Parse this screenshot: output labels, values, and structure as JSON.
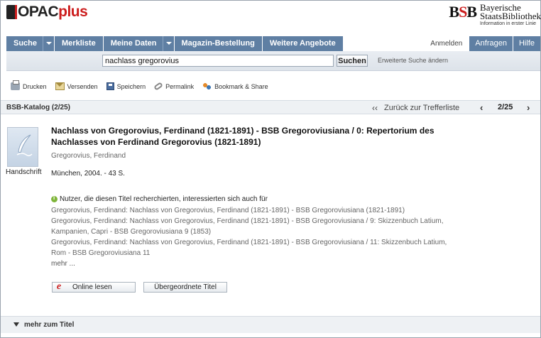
{
  "header": {
    "logo_opac": "OPAC",
    "logo_plus": "plus",
    "bsb_mark_b1": "B",
    "bsb_mark_s": "S",
    "bsb_mark_b2": "B",
    "bsb_line1": "Bayerische",
    "bsb_line2": "StaatsBibliothek",
    "bsb_line3": "Information in erster Linie"
  },
  "nav": {
    "search": "Suche",
    "watchlist": "Merkliste",
    "mydata": "Meine Daten",
    "stackorder": "Magazin-Bestellung",
    "more": "Weitere Angebote",
    "login": "Anmelden",
    "requests": "Anfragen",
    "help": "Hilfe"
  },
  "search": {
    "query": "nachlass gregorovius",
    "button": "Suchen",
    "advanced": "Erweiterte Suche ändern"
  },
  "toolbar": {
    "print": "Drucken",
    "send": "Versenden",
    "save": "Speichern",
    "permalink": "Permalink",
    "bookmark": "Bookmark & Share"
  },
  "results": {
    "catalog": "BSB-Katalog (2/25)",
    "back": "Zurück zur Trefferliste",
    "position": "2/25"
  },
  "record": {
    "type": "Handschrift",
    "title": "Nachlass von Gregorovius, Ferdinand (1821-1891) - BSB Gregoroviusiana / 0: Repertorium des Nachlasses von Ferdinand Gregorovius (1821-1891)",
    "author": "Gregorovius, Ferdinand",
    "pubinfo": "München, 2004. - 43 S.",
    "rec_heading": "Nutzer, die diesen Titel recherchierten, interessierten sich auch für",
    "rec_items": [
      "Gregorovius, Ferdinand: Nachlass von Gregorovius, Ferdinand (1821-1891) - BSB Gregoroviusiana (1821-1891)",
      "Gregorovius, Ferdinand: Nachlass von Gregorovius, Ferdinand (1821-1891) - BSB Gregoroviusiana / 9: Skizzenbuch Latium, Kampanien, Capri - BSB Gregoroviusiana 9 (1853)",
      "Gregorovius, Ferdinand: Nachlass von Gregorovius, Ferdinand (1821-1891) - BSB Gregoroviusiana / 11: Skizzenbuch Latium, Rom - BSB Gregoroviusiana 11"
    ],
    "rec_more": "mehr ...",
    "online_icon": "e",
    "online_button": "Online lesen",
    "parent_button": "Übergeordnete Titel"
  },
  "more_bar": {
    "label": "mehr zum Titel"
  },
  "icons": {
    "nav_dropdown": "chevron-down-icon",
    "back": "double-chevron-left-icon",
    "prev": "chevron-left-icon",
    "next": "chevron-right-icon",
    "print": "printer-icon",
    "send": "envelope-icon",
    "save": "floppy-disk-icon",
    "permalink": "link-icon",
    "bookmark": "share-icon",
    "info": "info-icon",
    "manuscript": "quill-icon",
    "expand": "triangle-down-icon"
  },
  "colors": {
    "nav_blue": "#5f7fa3",
    "brand_red": "#cc1d1d",
    "panel_gray": "#eef1f4"
  }
}
